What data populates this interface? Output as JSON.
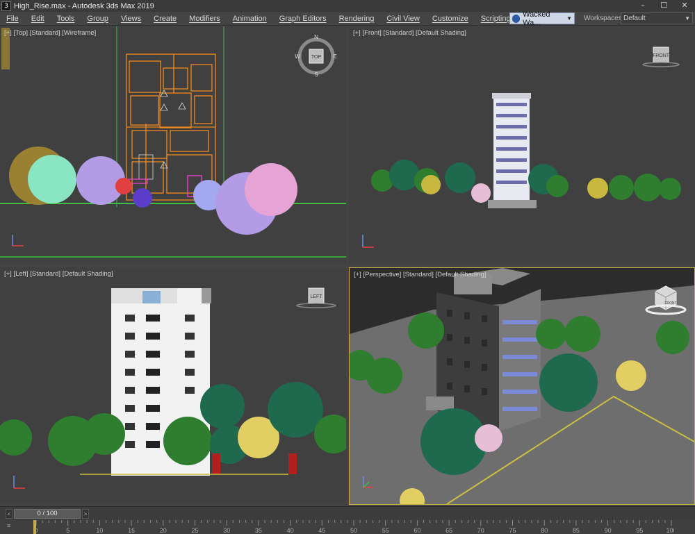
{
  "window": {
    "title": "High_Rise.max - Autodesk 3ds Max 2019",
    "app_icon_label": "3",
    "minimize": "–",
    "maximize": "☐",
    "close": "✕"
  },
  "menubar": {
    "items": [
      "File",
      "Edit",
      "Tools",
      "Group",
      "Views",
      "Create",
      "Modifiers",
      "Animation",
      "Graph Editors",
      "Rendering",
      "Civil View",
      "Customize",
      "Scripting"
    ],
    "more": "»",
    "user": "Wacked Wa...",
    "workspaces_label": "Workspaces:",
    "workspaces_value": "Default"
  },
  "viewports": {
    "top": {
      "label": "[+] [Top] [Standard] [Wireframe]",
      "cube_text": "TOP",
      "compass": [
        "N",
        "E",
        "S",
        "W"
      ]
    },
    "front": {
      "label": "[+] [Front] [Standard] [Default Shading]",
      "cube_text": "FRONT"
    },
    "left": {
      "label": "[+] [Left] [Standard] [Default Shading]",
      "cube_text": "LEFT"
    },
    "perspective": {
      "label": "[+] [Perspective] [Standard] [Default Shading]",
      "cube_text": "FRONT"
    }
  },
  "timeline": {
    "slider": "0 / 100",
    "prev": "<",
    "next": ">",
    "track_icon": "≡",
    "ticks": [
      "0",
      "5",
      "10",
      "15",
      "20",
      "25",
      "30",
      "35",
      "40",
      "45",
      "50",
      "55",
      "60",
      "65",
      "70",
      "75",
      "80",
      "85",
      "90",
      "95",
      "100"
    ]
  },
  "colors": {
    "accent": "#c9a94a",
    "viewport_bg": "#404040",
    "wire_orange": "#f08a1e",
    "ground_line": "#3fbf3f",
    "tree_green": "#2f7d2f",
    "tree_pink": "#e6a3d6",
    "tree_lilac": "#b49be6",
    "tree_yellow": "#e2cf63"
  }
}
